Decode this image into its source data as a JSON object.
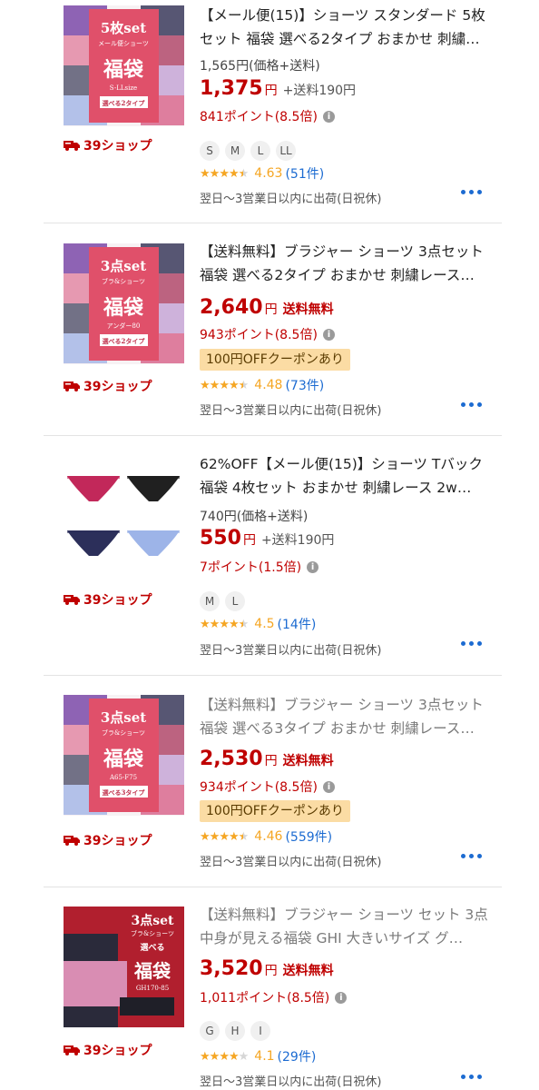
{
  "products": [
    {
      "thumb": {
        "type": "banner",
        "headline": "5枚set",
        "sub": "メール便ショーツ",
        "fuku": "福袋",
        "size": "S-LLsize",
        "badge": "選べる2タイプ"
      },
      "shop": "39ショップ",
      "title": "【メール便(15)】ショーツ スタンダード 5枚セット 福袋 選べる2タイプ おまかせ 刺繍…",
      "title_gray": false,
      "original_price": "1,565円(価格+送料)",
      "price": "1,375",
      "yen": "円",
      "shipping": "+送料190円",
      "shipping_free": false,
      "points": "841ポイント(8.5倍)",
      "coupon": "",
      "sizes": [
        "S",
        "M",
        "L",
        "LL"
      ],
      "rating_score": "4.63",
      "rating_stars": 4.5,
      "reviews": "(51件)",
      "delivery": "翌日〜3営業日以内に出荷(日祝休)"
    },
    {
      "thumb": {
        "type": "banner",
        "headline": "3点set",
        "sub": "ブラ&ショーツ",
        "fuku": "福袋",
        "size": "アンダー80",
        "badge": "選べる2タイプ"
      },
      "shop": "39ショップ",
      "title": "【送料無料】ブラジャー ショーツ 3点セット 福袋 選べる2タイプ おまかせ 刺繍レース…",
      "title_gray": false,
      "original_price": "",
      "price": "2,640",
      "yen": "円",
      "shipping": "送料無料",
      "shipping_free": true,
      "points": "943ポイント(8.5倍)",
      "coupon": "100円OFFクーポンあり",
      "sizes": [],
      "rating_score": "4.48",
      "rating_stars": 4.5,
      "reviews": "(73件)",
      "delivery": "翌日〜3営業日以内に出荷(日祝休)"
    },
    {
      "thumb": {
        "type": "panties"
      },
      "shop": "39ショップ",
      "title": "62%OFF【メール便(15)】ショーツ Tバック 福袋 4枚セット おまかせ 刺繍レース 2w…",
      "title_gray": false,
      "original_price": "740円(価格+送料)",
      "price": "550",
      "yen": "円",
      "shipping": "+送料190円",
      "shipping_free": false,
      "points": "7ポイント(1.5倍)",
      "coupon": "",
      "sizes": [
        "M",
        "L"
      ],
      "rating_score": "4.5",
      "rating_stars": 4.5,
      "reviews": "(14件)",
      "delivery": "翌日〜3営業日以内に出荷(日祝休)"
    },
    {
      "thumb": {
        "type": "banner",
        "headline": "3点set",
        "sub": "ブラ&ショーツ",
        "fuku": "福袋",
        "size": "A65-F75",
        "badge": "選べる3タイプ"
      },
      "shop": "39ショップ",
      "title": "【送料無料】ブラジャー ショーツ 3点セット 福袋 選べる3タイプ おまかせ 刺繍レース…",
      "title_gray": true,
      "original_price": "",
      "price": "2,530",
      "yen": "円",
      "shipping": "送料無料",
      "shipping_free": true,
      "points": "934ポイント(8.5倍)",
      "coupon": "100円OFFクーポンあり",
      "sizes": [],
      "rating_score": "4.46",
      "rating_stars": 4.5,
      "reviews": "(559件)",
      "delivery": "翌日〜3営業日以内に出荷(日祝休)"
    },
    {
      "thumb": {
        "type": "banner5",
        "headline": "3点set",
        "sub": "ブラ&ショーツ",
        "choose": "選べる",
        "fuku": "福袋",
        "size": "GH170-85"
      },
      "shop": "39ショップ",
      "title": "【送料無料】ブラジャー ショーツ セット 3点 中身が見える福袋 GHI 大きいサイズ グ…",
      "title_gray": true,
      "original_price": "",
      "price": "3,520",
      "yen": "円",
      "shipping": "送料無料",
      "shipping_free": true,
      "points": "1,011ポイント(8.5倍)",
      "coupon": "",
      "sizes": [
        "G",
        "H",
        "I"
      ],
      "rating_score": "4.1",
      "rating_stars": 4,
      "reviews": "(29件)",
      "delivery": "翌日〜3営業日以内に出荷(日祝休)"
    }
  ],
  "colors": {
    "price": "#bf0000",
    "coupon_bg": "#fbdca4",
    "star": "#f5a623",
    "link": "#1c6bd1",
    "banner": "#e0506a"
  }
}
